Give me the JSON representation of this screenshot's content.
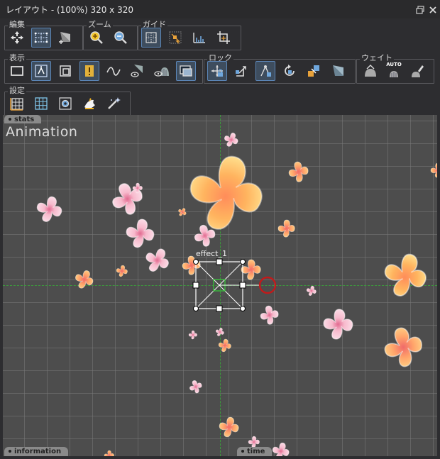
{
  "window": {
    "title": "レイアウト - (100%) 320 x 320"
  },
  "groups": {
    "edit": {
      "label": "編集"
    },
    "zoom": {
      "label": "ズーム"
    },
    "guide": {
      "label": "ガイド"
    },
    "display": {
      "label": "表示"
    },
    "lock": {
      "label": "ロック"
    },
    "weight": {
      "label": "ウェイト"
    },
    "settings": {
      "label": "設定"
    }
  },
  "weight_auto_label": "AUTO",
  "canvas": {
    "overlay_title": "Animation",
    "selected_object": "effect_1",
    "tabs": {
      "stats": "stats",
      "information": "information",
      "time": "time"
    }
  },
  "colors": {
    "toggle_on_bg": "#3e4d5e",
    "toggle_on_border": "#5b86b8",
    "guide_green": "#3c9a3c",
    "handle_red": "#c21a1a",
    "petal_pink": "#f5b4c8",
    "petal_orange": "#ffb066"
  }
}
